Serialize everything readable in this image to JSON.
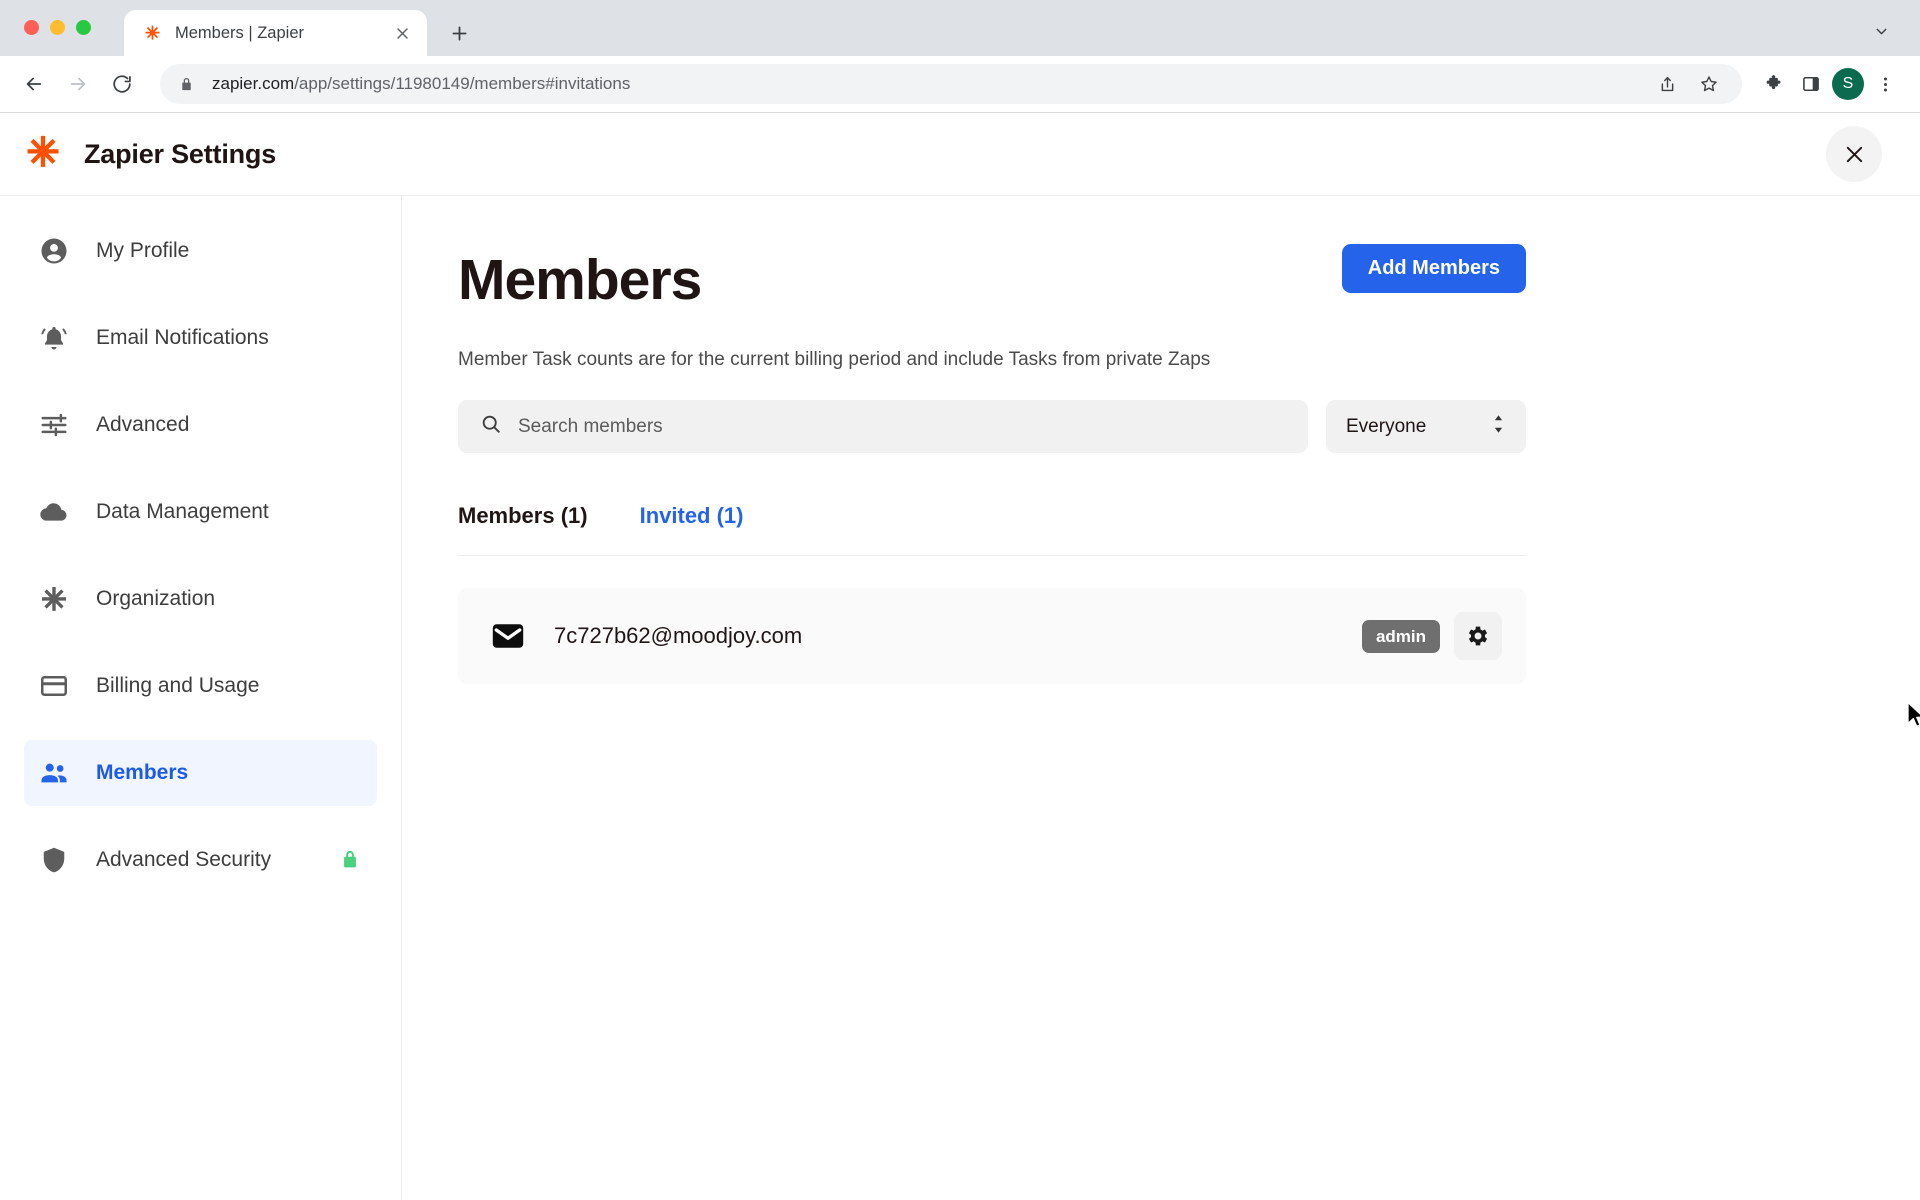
{
  "browser": {
    "tab": {
      "title": "Members | Zapier",
      "favicon_icon": "zapier-asterisk-icon",
      "close_icon": "close-icon"
    },
    "new_tab_icon": "plus-icon",
    "tab_list_icon": "chevron-down-icon",
    "nav": {
      "back_icon": "arrow-back-icon",
      "forward_icon": "arrow-forward-icon",
      "reload_icon": "reload-icon"
    },
    "omnibox": {
      "lock_icon": "lock-icon",
      "url_host": "zapier.com",
      "url_path": "/app/settings/11980149/members#invitations",
      "full_url": "zapier.com/app/settings/11980149/members#invitations"
    },
    "actions": {
      "share_icon": "share-icon",
      "bookmark_icon": "star-icon",
      "extensions_icon": "puzzle-icon",
      "side_panel_icon": "side-panel-icon",
      "profile_initial": "S",
      "menu_icon": "three-dot-menu-icon"
    },
    "traffic_lights": [
      "close",
      "minimize",
      "maximize"
    ]
  },
  "header": {
    "logo_icon": "zapier-asterisk-icon",
    "title": "Zapier Settings",
    "close_icon": "close-icon"
  },
  "sidebar": {
    "items": [
      {
        "label": "My Profile",
        "icon": "person-circle-icon",
        "active": false
      },
      {
        "label": "Email Notifications",
        "icon": "bell-icon",
        "active": false
      },
      {
        "label": "Advanced",
        "icon": "sliders-icon",
        "active": false
      },
      {
        "label": "Data Management",
        "icon": "cloud-icon",
        "active": false
      },
      {
        "label": "Organization",
        "icon": "asterisk-icon",
        "active": false
      },
      {
        "label": "Billing and Usage",
        "icon": "credit-card-icon",
        "active": false
      },
      {
        "label": "Members",
        "icon": "people-icon",
        "active": true
      },
      {
        "label": "Advanced Security",
        "icon": "shield-icon",
        "active": false,
        "badge_icon": "lock-icon"
      }
    ]
  },
  "main": {
    "page_title": "Members",
    "add_members_label": "Add Members",
    "subtitle": "Member Task counts are for the current billing period and include Tasks from private Zaps",
    "search": {
      "placeholder": "Search members",
      "value": "",
      "icon": "search-icon"
    },
    "filter_select": {
      "value": "Everyone",
      "icon": "up-down-chevron-icon"
    },
    "tabs": [
      {
        "label": "Members (1)",
        "active": true
      },
      {
        "label": "Invited (1)",
        "active": false
      }
    ],
    "invited_rows": [
      {
        "icon": "mail-icon",
        "email": "7c727b62@moodjoy.com",
        "role": "admin",
        "settings_icon": "gear-icon"
      }
    ]
  },
  "colors": {
    "accent_blue": "#2563eb",
    "zapier_orange": "#ff4f00",
    "badge_gray": "#6f6f6f",
    "lock_green": "#4ad07e",
    "avatar_green": "#0b6b4f"
  }
}
